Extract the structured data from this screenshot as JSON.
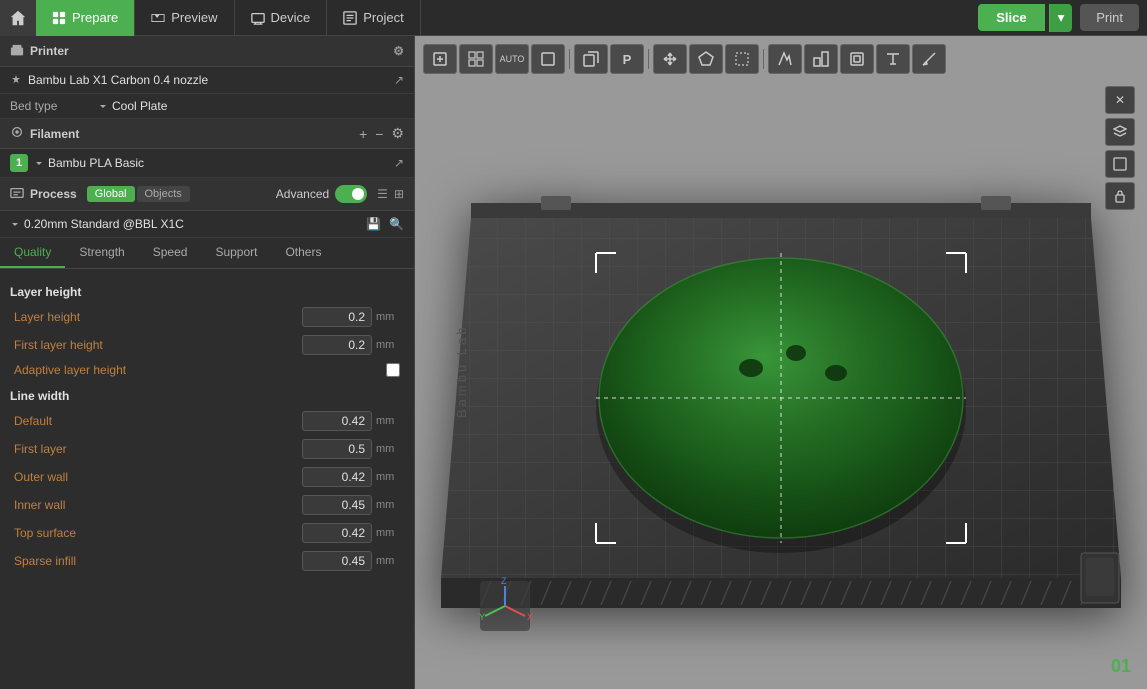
{
  "topbar": {
    "tabs": [
      {
        "id": "prepare",
        "label": "Prepare",
        "active": true
      },
      {
        "id": "preview",
        "label": "Preview",
        "active": false
      },
      {
        "id": "device",
        "label": "Device",
        "active": false
      },
      {
        "id": "project",
        "label": "Project",
        "active": false
      }
    ],
    "slice_label": "Slice",
    "print_label": "Print"
  },
  "printer": {
    "section_label": "Printer",
    "name": "Bambu Lab X1 Carbon 0.4 nozzle",
    "bed_type_label": "Bed type",
    "bed_type_value": "Cool Plate"
  },
  "filament": {
    "section_label": "Filament",
    "items": [
      {
        "num": "1",
        "name": "Bambu PLA Basic"
      }
    ]
  },
  "process": {
    "section_label": "Process",
    "badge_global": "Global",
    "badge_objects": "Objects",
    "advanced_label": "Advanced",
    "preset": "0.20mm Standard @BBL X1C"
  },
  "tabs": {
    "items": [
      "Quality",
      "Strength",
      "Speed",
      "Support",
      "Others"
    ],
    "active": "Quality"
  },
  "quality": {
    "layer_height_group": "Layer height",
    "layer_height_label": "Layer height",
    "layer_height_value": "0.2",
    "layer_height_unit": "mm",
    "first_layer_height_label": "First layer height",
    "first_layer_height_value": "0.2",
    "first_layer_height_unit": "mm",
    "adaptive_layer_height_label": "Adaptive layer height",
    "line_width_group": "Line width",
    "default_label": "Default",
    "default_value": "0.42",
    "default_unit": "mm",
    "first_layer_label": "First layer",
    "first_layer_value": "0.5",
    "first_layer_unit": "mm",
    "outer_wall_label": "Outer wall",
    "outer_wall_value": "0.42",
    "outer_wall_unit": "mm",
    "inner_wall_label": "Inner wall",
    "inner_wall_value": "0.45",
    "inner_wall_unit": "mm",
    "top_surface_label": "Top surface",
    "top_surface_value": "0.42",
    "top_surface_unit": "mm",
    "sparse_infill_label": "Sparse infill",
    "sparse_infill_value": "0.45",
    "sparse_infill_unit": "mm"
  },
  "viewport": {
    "version": "01"
  }
}
